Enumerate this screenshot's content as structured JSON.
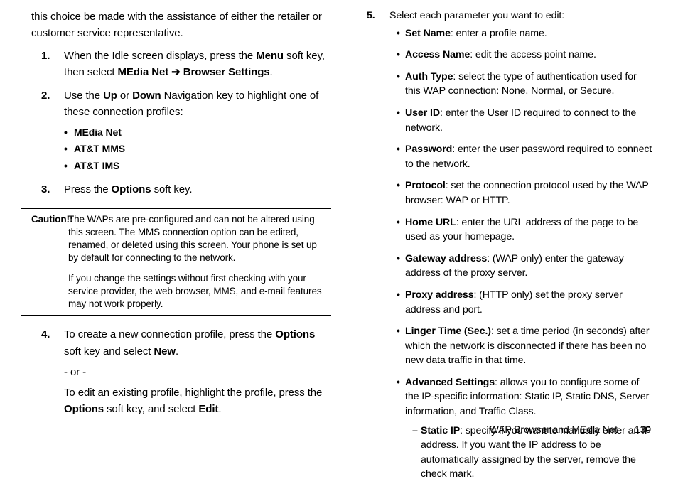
{
  "left": {
    "intro": "this choice be made with the assistance of either the retailer or customer service representative.",
    "step1_a": "When the Idle screen displays, press the ",
    "step1_b": " soft key, then select ",
    "step1_bold_menu": "Menu",
    "step1_bold_media": "MEdia Net",
    "step1_arrow": " ➔ ",
    "step1_bold_browser": "Browser Settings",
    "step1_c": ".",
    "step2_a": "Use the ",
    "step2_up": "Up",
    "step2_mid": " or ",
    "step2_down": "Down",
    "step2_b": " Navigation key to highlight one of these connection profiles:",
    "profiles": [
      "MEdia Net",
      "AT&T MMS",
      "AT&T IMS"
    ],
    "step3_a": "Press the ",
    "step3_options": "Options",
    "step3_b": " soft key.",
    "caution_label": "Caution!:",
    "caution_p1": "The WAPs are pre-configured and can not be altered using this screen. The MMS connection option can be edited, renamed, or deleted using this screen. Your phone is set up by default for connecting to the network.",
    "caution_p2": "If you change the settings without first checking with your service provider, the web browser, MMS, and e-mail features may not work properly.",
    "step4_a": "To create a new connection profile, press the ",
    "step4_options": "Options",
    "step4_b": " soft key and select ",
    "step4_new": "New",
    "step4_c": ".",
    "step4_or": "- or -",
    "step4_d": "To edit an existing profile, highlight the profile, press the ",
    "step4_options2": "Options",
    "step4_e": " soft key, and select ",
    "step4_edit": "Edit",
    "step4_f": "."
  },
  "right": {
    "step5": "Select each parameter you want to edit:",
    "params": [
      {
        "name": "Set Name",
        "desc": ": enter a profile name."
      },
      {
        "name": "Access Name",
        "desc": ": edit the access point name."
      },
      {
        "name": "Auth Type",
        "desc": ": select the type of authentication used for this WAP connection: None, Normal, or Secure."
      },
      {
        "name": "User ID",
        "desc": ": enter the User ID required to connect to the network."
      },
      {
        "name": "Password",
        "desc": ": enter the user password required to connect to the network."
      },
      {
        "name": "Protocol",
        "desc": ": set the connection protocol used by the WAP browser: WAP or HTTP."
      },
      {
        "name": "Home URL",
        "desc": ": enter the URL address of the page to be used as your homepage."
      },
      {
        "name": "Gateway address",
        "desc": ": (WAP only) enter the gateway address of the proxy server."
      },
      {
        "name": "Proxy address",
        "desc": ": (HTTP only) set the proxy server address and port."
      },
      {
        "name": "Linger Time (Sec.)",
        "desc": ": set a time period (in seconds) after which the network is disconnected if there has been no new data traffic in that time."
      },
      {
        "name": "Advanced Settings",
        "desc": ": allows you to configure some of the IP-specific information: Static IP, Static DNS, Server information, and Traffic Class."
      }
    ],
    "sub_name": "Static IP",
    "sub_desc": ": specify if you want to manually enter an IP address. If you want the IP address to be automatically assigned by the server, remove the check mark."
  },
  "footer": {
    "title": "WAP Browser and MEdia Net",
    "page": "130"
  }
}
